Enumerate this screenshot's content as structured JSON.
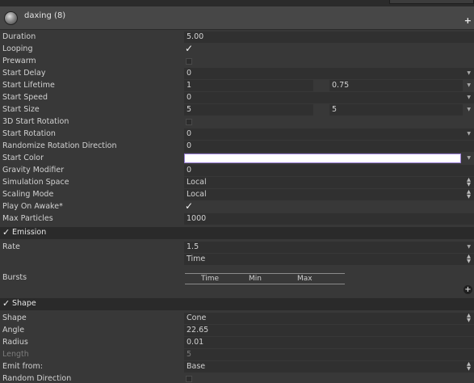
{
  "header": {
    "title": "daxing (8)",
    "add_symbol": "+"
  },
  "properties": [
    {
      "label": "Duration",
      "value": "5.00"
    },
    {
      "label": "Looping",
      "checked": true
    },
    {
      "label": "Prewarm",
      "checked": false
    },
    {
      "label": "Start Delay",
      "value": "0"
    },
    {
      "label": "Start Lifetime",
      "value": "1",
      "value2": "0.75"
    },
    {
      "label": "Start Speed",
      "value": "0"
    },
    {
      "label": "Start Size",
      "value": "5",
      "value2": "5"
    },
    {
      "label": "3D Start Rotation",
      "checked": false
    },
    {
      "label": "Start Rotation",
      "value": "0"
    },
    {
      "label": "Randomize Rotation Direction",
      "value": "0"
    },
    {
      "label": "Start Color",
      "color": "#ffffff"
    },
    {
      "label": "Gravity Modifier",
      "value": "0"
    },
    {
      "label": "Simulation Space",
      "value": "Local"
    },
    {
      "label": "Scaling Mode",
      "value": "Local"
    },
    {
      "label": "Play On Awake*",
      "checked": true
    },
    {
      "label": "Max Particles",
      "value": "1000"
    }
  ],
  "emission": {
    "title": "Emission",
    "rate_label": "Rate",
    "rate_value": "1.5",
    "rate_mode": "Time",
    "bursts_label": "Bursts",
    "bursts_columns": [
      "Time",
      "Min",
      "Max"
    ]
  },
  "shape": {
    "title": "Shape",
    "rows": [
      {
        "label": "Shape",
        "value": "Cone"
      },
      {
        "label": "Angle",
        "value": "22.65"
      },
      {
        "label": "Radius",
        "value": "0.01"
      },
      {
        "label": "Length",
        "value": "5"
      },
      {
        "label": "Emit from:",
        "value": "Base"
      },
      {
        "label": "Random Direction",
        "checked": false
      }
    ]
  },
  "icons": {
    "checkmark": "✓",
    "dropdown_arrow": "▼",
    "updown_arrows": "▲▼",
    "add": "+"
  }
}
